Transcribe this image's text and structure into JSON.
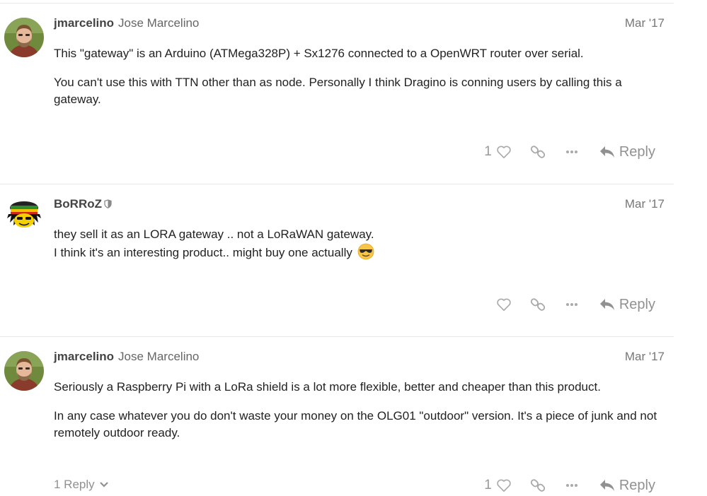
{
  "posts": [
    {
      "username": "jmarcelino",
      "fullname": "Jose Marcelino",
      "date": "Mar '17",
      "paragraphs": [
        "This \"gateway\" is an Arduino (ATMega328P) + Sx1276 connected to a OpenWRT router over serial.",
        "You can't use this with TTN other than as node. Personally I think Dragino is conning users by calling this a gateway."
      ],
      "like_count": "1",
      "reply_label": "Reply"
    },
    {
      "username": "BoRRoZ",
      "date": "Mar '17",
      "paragraphs": [
        "they sell it as an LORA gateway .. not a LoRaWAN gateway.",
        "I think it's an interesting product.. might buy one actually"
      ],
      "emoji": "sunglasses-emoji",
      "reply_label": "Reply"
    },
    {
      "username": "jmarcelino",
      "fullname": "Jose Marcelino",
      "date": "Mar '17",
      "paragraphs": [
        "Seriously a Raspberry Pi with a LoRa shield is a lot more flexible, better and cheaper than this product.",
        "In any case whatever you do don't waste your money on the OLG01 \"outdoor\" version. It's a piece of junk and not remotely outdoor ready."
      ],
      "replies_toggle": "1 Reply",
      "like_count": "1",
      "reply_label": "Reply"
    }
  ],
  "icons": {
    "like": "heart-icon",
    "link": "link-icon",
    "more": "ellipsis-icon",
    "reply": "reply-arrow-icon",
    "moderator": "shield-icon",
    "expand": "chevron-down-icon"
  },
  "colors": {
    "text": "#222222",
    "muted": "#919191",
    "divider": "#e9e9e9"
  }
}
